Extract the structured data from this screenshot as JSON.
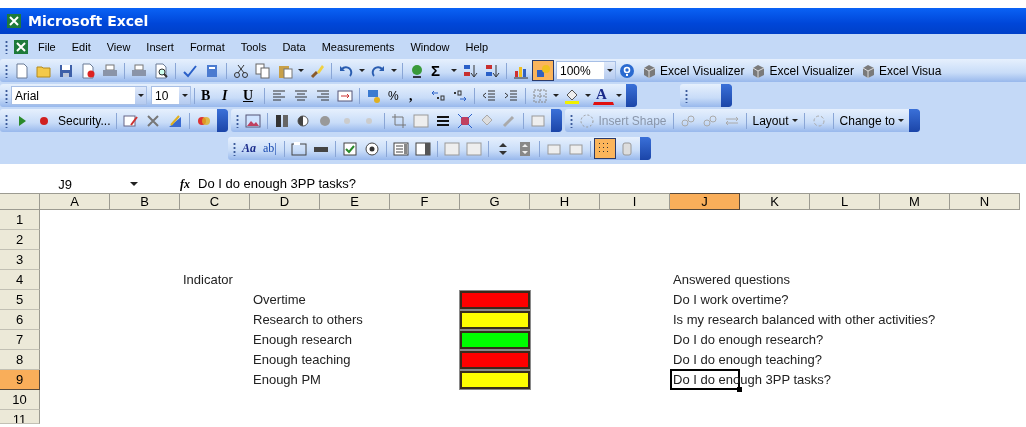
{
  "window": {
    "title": "Microsoft Excel"
  },
  "menu": [
    "File",
    "Edit",
    "View",
    "Insert",
    "Format",
    "Tools",
    "Data",
    "Measurements",
    "Window",
    "Help"
  ],
  "standard_toolbar": {
    "sum": "Σ",
    "drawing_pressed": true,
    "zoom": "100%",
    "visualizer_buttons": [
      "Excel Visualizer",
      "Excel Visualizer",
      "Excel Visua"
    ]
  },
  "formatting_toolbar": {
    "font": "Arial",
    "size": "10",
    "bold": "B",
    "italic": "I",
    "underline": "U",
    "percent": "%",
    "comma": ",",
    "font_color": "A"
  },
  "control_toolbar": {
    "security": "Security...",
    "insert_shape": "Insert Shape",
    "insert_shape_disabled": true,
    "layout": "Layout",
    "change_to": "Change to"
  },
  "forms_toolbar": {
    "label": "Aa",
    "edit_box": "ab|",
    "grid_pressed": true
  },
  "formula_bar": {
    "name_box": "J9",
    "fx": "fx",
    "formula": "Do I do enough 3PP tasks?"
  },
  "sheet": {
    "columns": [
      {
        "label": "A",
        "selected": false
      },
      {
        "label": "B",
        "selected": false
      },
      {
        "label": "C",
        "selected": false
      },
      {
        "label": "D",
        "selected": false
      },
      {
        "label": "E",
        "selected": false
      },
      {
        "label": "F",
        "selected": false
      },
      {
        "label": "G",
        "selected": false
      },
      {
        "label": "H",
        "selected": false
      },
      {
        "label": "I",
        "selected": false
      },
      {
        "label": "J",
        "selected": true
      },
      {
        "label": "K",
        "selected": false
      },
      {
        "label": "L",
        "selected": false
      },
      {
        "label": "M",
        "selected": false
      },
      {
        "label": "N",
        "selected": false
      }
    ],
    "rows": [
      {
        "label": "1",
        "selected": false
      },
      {
        "label": "2",
        "selected": false
      },
      {
        "label": "3",
        "selected": false
      },
      {
        "label": "4",
        "selected": false
      },
      {
        "label": "5",
        "selected": false
      },
      {
        "label": "6",
        "selected": false
      },
      {
        "label": "7",
        "selected": false
      },
      {
        "label": "8",
        "selected": false
      },
      {
        "label": "9",
        "selected": true
      },
      {
        "label": "10",
        "selected": false
      },
      {
        "label": "11",
        "selected": false
      }
    ],
    "indicator_heading": "Indicator",
    "questions_heading": "Answered questions",
    "indicators": [
      {
        "label": "Overtime",
        "color": "#ff0000",
        "question": "Do I work overtime?",
        "selected": false
      },
      {
        "label": "Research to others",
        "color": "#ffff00",
        "question": "Is my research balanced with other activities?",
        "selected": false
      },
      {
        "label": "Enough research",
        "color": "#00ff00",
        "question": "Do I do enough research?",
        "selected": false
      },
      {
        "label": "Enough teaching",
        "color": "#ff0000",
        "question": "Do I do enough teaching?",
        "selected": false
      },
      {
        "label": "Enough PM",
        "color": "#ffff00",
        "question": "Do I do enough 3PP tasks?",
        "selected": true
      }
    ]
  }
}
